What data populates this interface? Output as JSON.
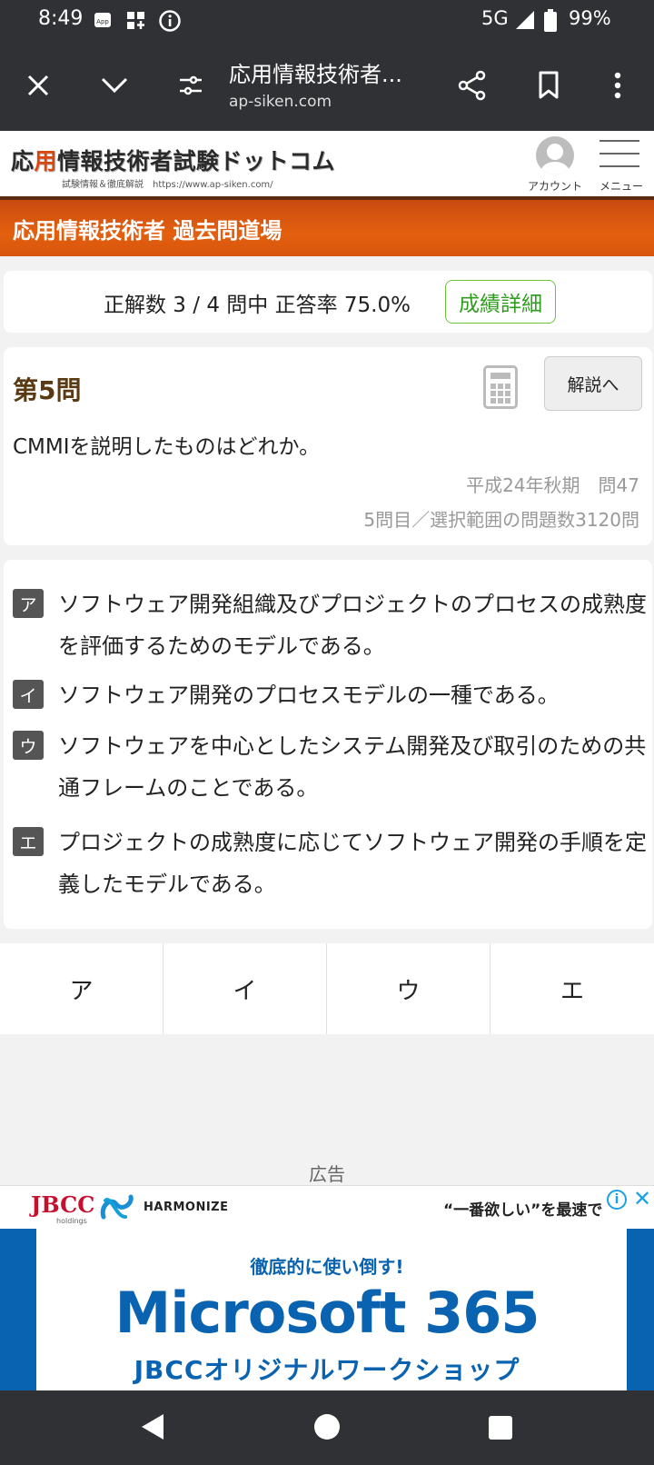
{
  "status_bar": {
    "time": "8:49",
    "network": "5G",
    "battery": "99%",
    "icons": [
      "app-notification-icon",
      "widget-icon",
      "info-icon",
      "signal-icon",
      "battery-icon"
    ]
  },
  "browser": {
    "page_title": "応用情報技術者...",
    "url": "ap-siken.com",
    "icons": [
      "close-icon",
      "chevron-down-icon",
      "site-settings-icon",
      "share-icon",
      "bookmark-icon",
      "more-vert-icon"
    ]
  },
  "site": {
    "logo_prefix": "応",
    "logo_highlight": "用",
    "logo_rest": "情報技術者試験ドットコム",
    "logo_sub": "試験情報＆徹底解説　https://www.ap-siken.com/",
    "account_label": "アカウント",
    "menu_label": "メニュー"
  },
  "banner": {
    "title": "応用情報技術者 過去問道場"
  },
  "score": {
    "text": "正解数 3 / 4 問中 正答率 75.0%",
    "detail_button": "成績詳細"
  },
  "question": {
    "number": "第5問",
    "explain_button": "解説へ",
    "text": "CMMIを説明したものはどれか。",
    "source": "平成24年秋期　問47",
    "progress": "5問目／選択範囲の問題数3120問"
  },
  "choices": [
    {
      "mark": "ア",
      "text": "ソフトウェア開発組織及びプロジェクトのプロセスの成熟度を評価するためのモデルである。"
    },
    {
      "mark": "イ",
      "text": "ソフトウェア開発のプロセスモデルの一種である。"
    },
    {
      "mark": "ウ",
      "text": "ソフトウェアを中心としたシステム開発及び取引のための共通フレームのことである。"
    },
    {
      "mark": "エ",
      "text": "プロジェクトの成熟度に応じてソフトウェア開発の手順を定義したモデルである。"
    }
  ],
  "answers": [
    "ア",
    "イ",
    "ウ",
    "エ"
  ],
  "ad": {
    "label": "広告",
    "brand1": "JBCC",
    "brand1_sub": "holdings",
    "brand2": "HARMONIZE",
    "top_copy": "“一番欲しい”を最速で",
    "tagline": "徹底的に使い倒す!",
    "headline": "Microsoft 365",
    "subline": "JBCCオリジナルワークショップ"
  },
  "colors": {
    "status_bg": "#303134",
    "banner_orange": "#e4600f",
    "logo_accent": "#d9480f",
    "detail_green": "#2f9e1f",
    "ad_blue": "#0a63b0"
  }
}
